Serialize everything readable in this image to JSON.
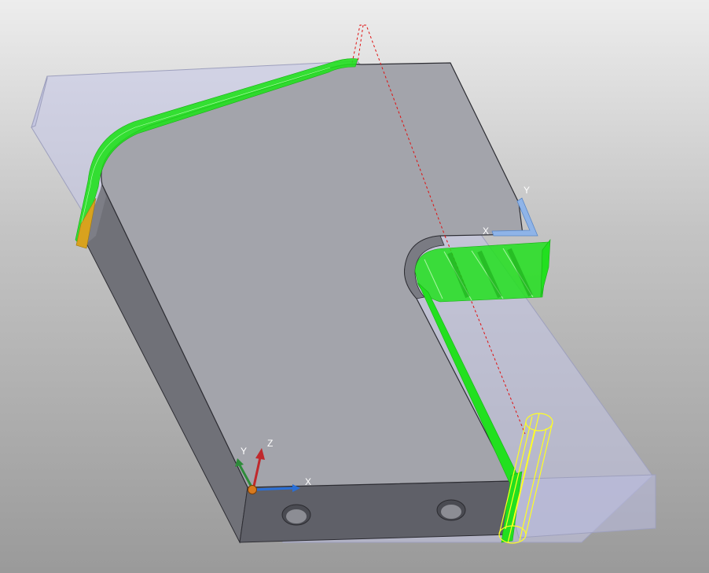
{
  "scene": {
    "world_axes": {
      "x_label": "X",
      "y_label": "Y",
      "z_label": "Z"
    },
    "local_axes": {
      "x_label": "X",
      "y_label": "Y"
    }
  },
  "colors": {
    "background_top": "#ededed",
    "background_bottom": "#9a9a9a",
    "part_top": "#a3a4ab",
    "part_side_left": "#707178",
    "part_side_front": "#5f6068",
    "stock": "#c4c6e8",
    "toolpath": "#22e01f",
    "tool": "#ffff22",
    "link_move": "#e01010",
    "axis_x": "#2a6fd6",
    "axis_y": "#2e8b3a",
    "axis_z": "#c0282c",
    "origin": "#d87a1e",
    "local_axes": "#8fb4e8"
  },
  "icons": {
    "origin": "origin-marker-icon",
    "tool": "cutting-tool-icon",
    "hole": "drilled-hole-icon"
  }
}
